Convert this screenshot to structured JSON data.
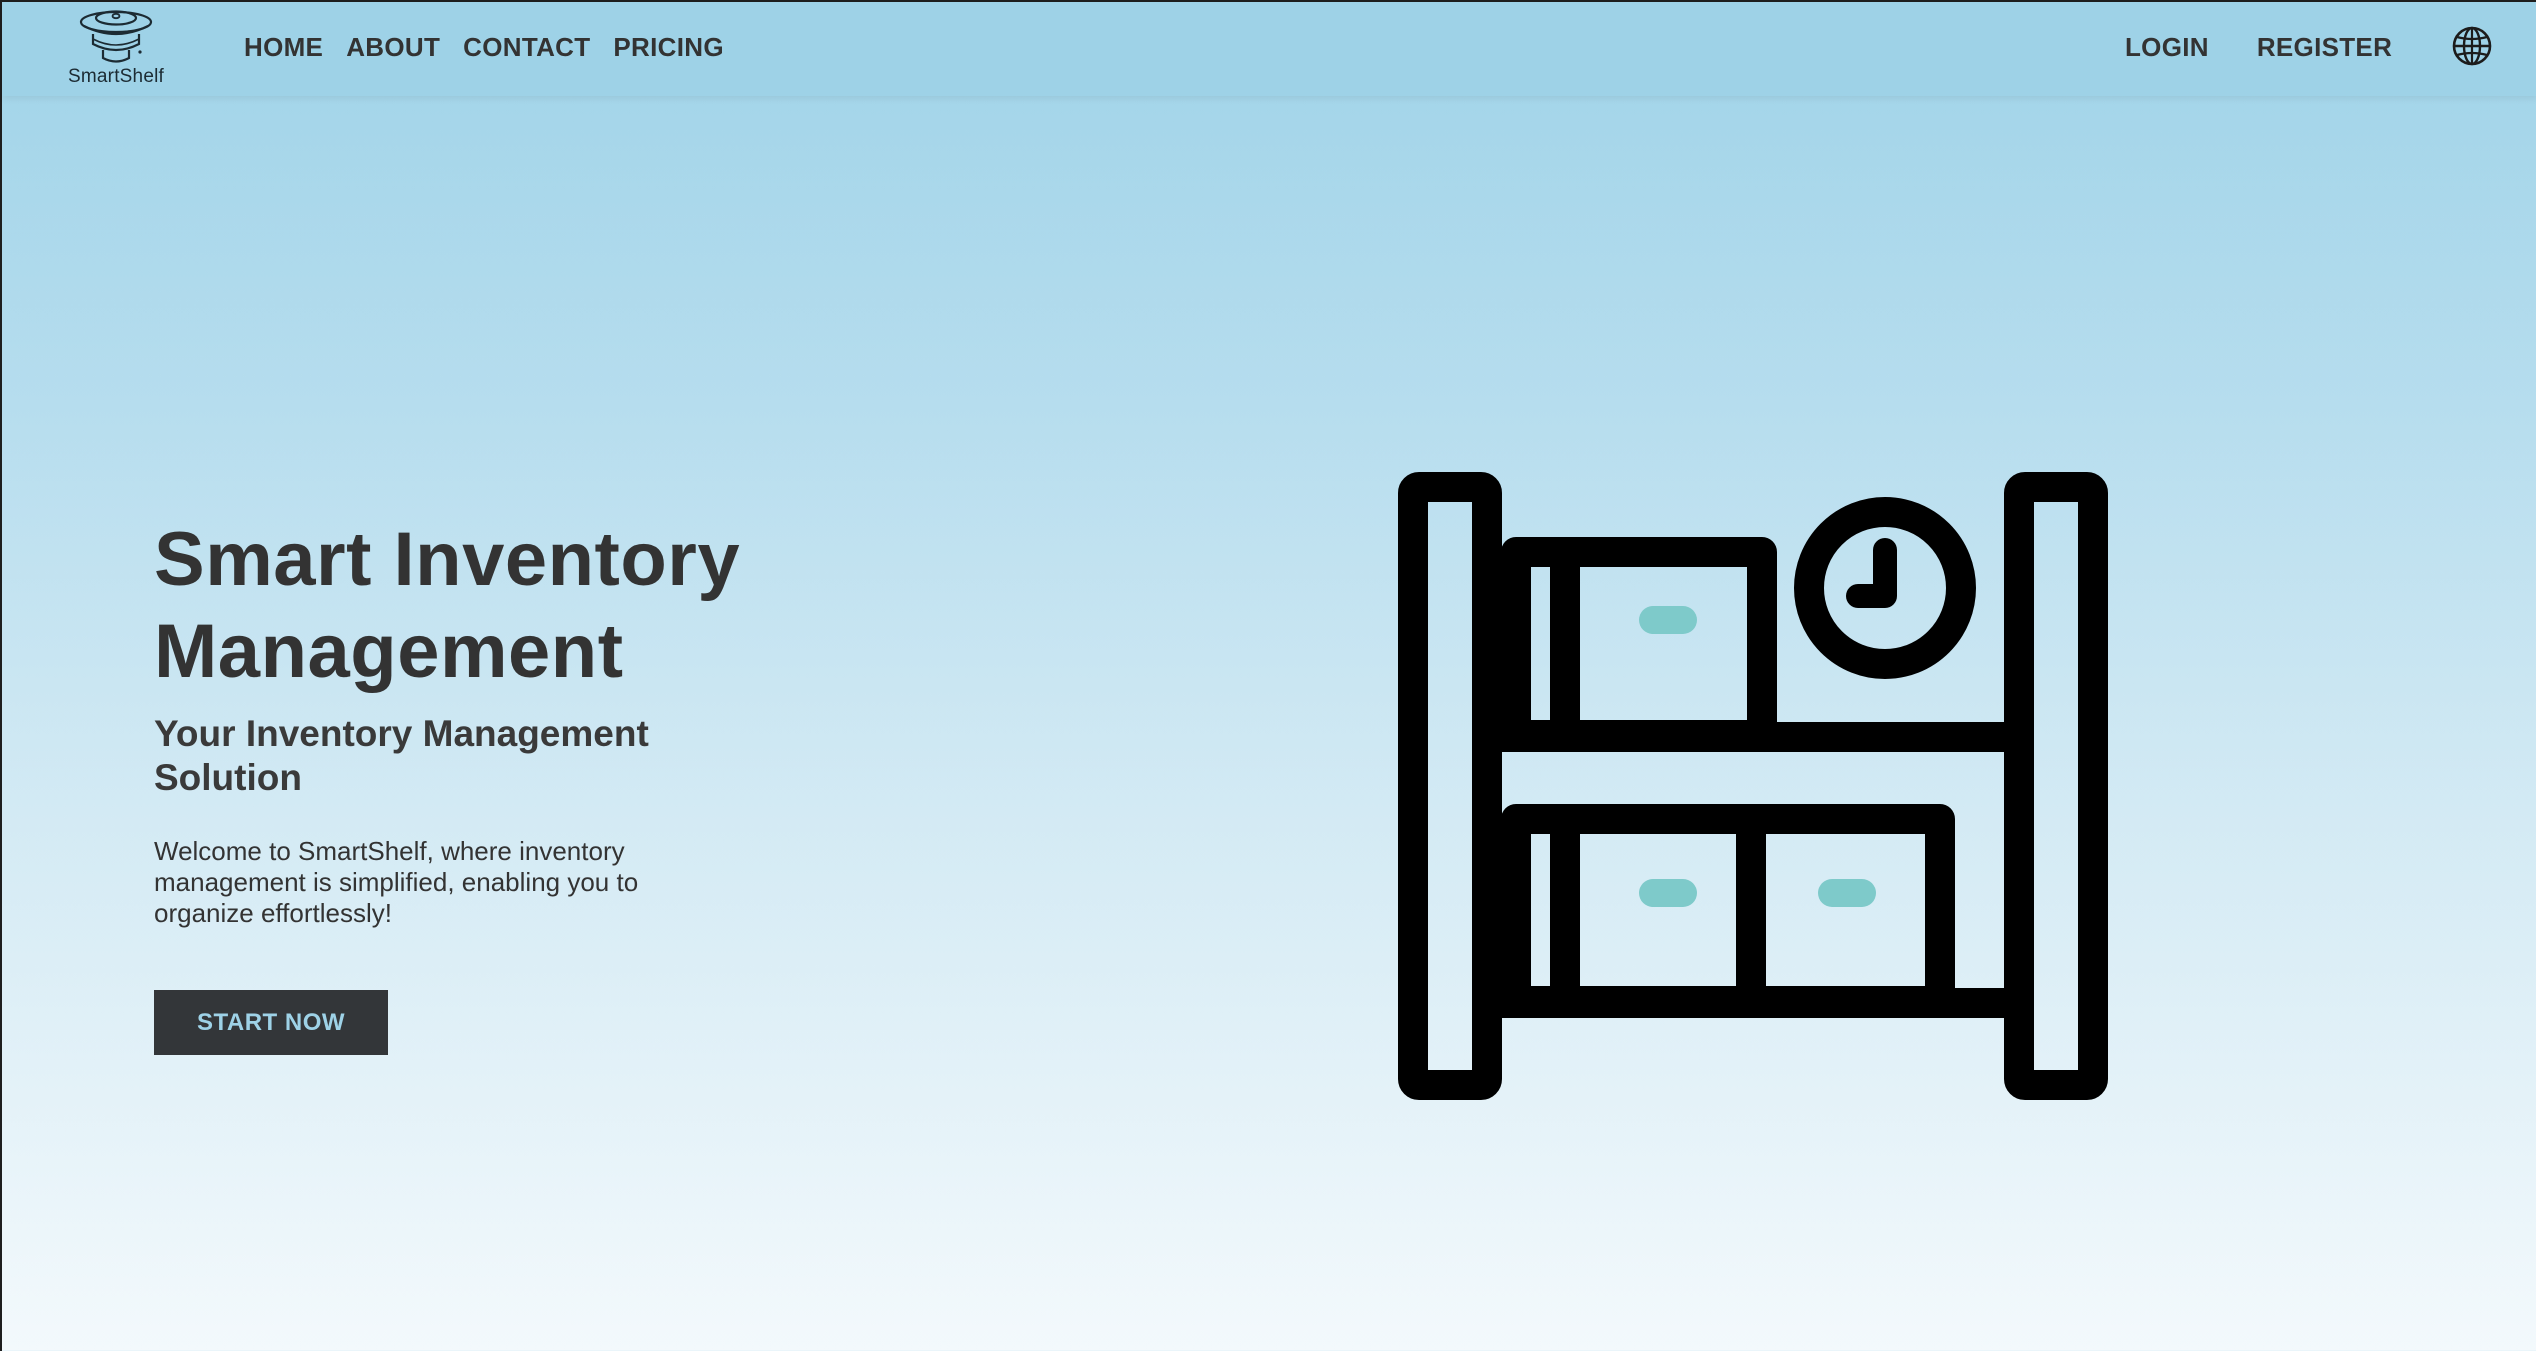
{
  "brand": {
    "name": "SmartShelf",
    "logo_icon": "stacked-disks-logo"
  },
  "nav": {
    "left": [
      {
        "label": "HOME"
      },
      {
        "label": "ABOUT"
      },
      {
        "label": "CONTACT"
      },
      {
        "label": "PRICING"
      }
    ],
    "right": [
      {
        "label": "LOGIN"
      },
      {
        "label": "REGISTER"
      }
    ],
    "language_icon": "globe-icon"
  },
  "hero": {
    "title": "Smart Inventory Management",
    "subtitle": "Your Inventory Management Solution",
    "description": "Welcome to SmartShelf, where inventory management is simplified, enabling you to organize effortlessly!",
    "cta_label": "START NOW",
    "illustration_icon": "shelf-with-boxes-and-clock-icon"
  },
  "colors": {
    "nav_background": "#9ed2e7",
    "gradient_top": "#9fd3e8",
    "gradient_bottom": "#f3f9fc",
    "text_dark": "#333333",
    "button_background": "#333639",
    "button_text": "#9ed2e7",
    "box_handle": "#7ecaca"
  }
}
